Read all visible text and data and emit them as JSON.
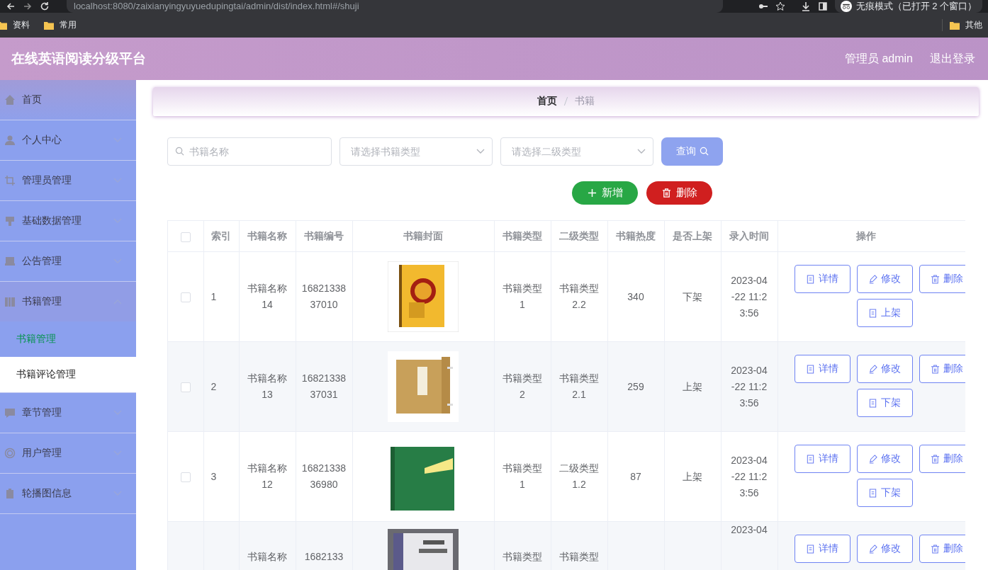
{
  "browser": {
    "url": "localhost:8080/zaixianyingyuyuedupingtai/admin/dist/index.html#/shuji",
    "incognito": "无痕模式（已打开 2 个窗口）",
    "bookmarks": [
      "资料",
      "常用"
    ],
    "other_bookmarks": "其他"
  },
  "header": {
    "title": "在线英语阅读分级平台",
    "user": "管理员 admin",
    "logout": "退出登录"
  },
  "sidebar": {
    "items": [
      {
        "label": "首页",
        "kind": "link"
      },
      {
        "label": "个人中心",
        "kind": "submenu",
        "expanded": false
      },
      {
        "label": "管理员管理",
        "kind": "submenu",
        "expanded": false
      },
      {
        "label": "基础数据管理",
        "kind": "submenu",
        "expanded": false
      },
      {
        "label": "公告管理",
        "kind": "submenu",
        "expanded": false
      },
      {
        "label": "书籍管理",
        "kind": "submenu",
        "expanded": true,
        "children": [
          {
            "label": "书籍管理",
            "selected": true,
            "hovered": false
          },
          {
            "label": "书籍评论管理",
            "selected": false,
            "hovered": true
          }
        ]
      },
      {
        "label": "章节管理",
        "kind": "submenu",
        "expanded": false
      },
      {
        "label": "用户管理",
        "kind": "submenu",
        "expanded": false
      },
      {
        "label": "轮播图信息",
        "kind": "submenu",
        "expanded": false
      }
    ]
  },
  "breadcrumb": [
    "首页",
    "书籍"
  ],
  "search": {
    "name_placeholder": "书籍名称",
    "type_placeholder": "请选择书籍类型",
    "subtype_placeholder": "请选择二级类型",
    "query_button": "查询"
  },
  "actions": {
    "add": "新增",
    "delete": "删除"
  },
  "table": {
    "select_all_checked": false,
    "columns": [
      "索引",
      "书籍名称",
      "书籍编号",
      "书籍封面",
      "书籍类型",
      "二级类型",
      "书籍热度",
      "是否上架",
      "录入时间",
      "操作"
    ],
    "rows": [
      {
        "checked": false,
        "index": "1",
        "name": "书籍名称14",
        "code": "1682133837010",
        "type": "书籍类型1",
        "subtype": "书籍类型2.2",
        "heat": "340",
        "status": "下架",
        "time": "2023-04-22 11:23:56",
        "buttons": [
          "详情",
          "修改",
          "删除",
          "上架"
        ]
      },
      {
        "checked": false,
        "index": "2",
        "name": "书籍名称13",
        "code": "1682133837031",
        "type": "书籍类型2",
        "subtype": "书籍类型2.1",
        "heat": "259",
        "status": "上架",
        "time": "2023-04-22 11:23:56",
        "buttons": [
          "详情",
          "修改",
          "删除",
          "下架"
        ]
      },
      {
        "checked": false,
        "index": "3",
        "name": "书籍名称12",
        "code": "1682133836980",
        "type": "书籍类型1",
        "subtype": "二级类型1.2",
        "heat": "87",
        "status": "上架",
        "time": "2023-04-22 11:23:56",
        "buttons": [
          "详情",
          "修改",
          "删除",
          "下架"
        ]
      },
      {
        "name": "书籍名称",
        "code": "1682133",
        "type": "书籍类型",
        "subtype": "书籍类型",
        "time": "2023-04",
        "buttons": [
          "详情",
          "修改",
          "删除"
        ]
      }
    ]
  }
}
